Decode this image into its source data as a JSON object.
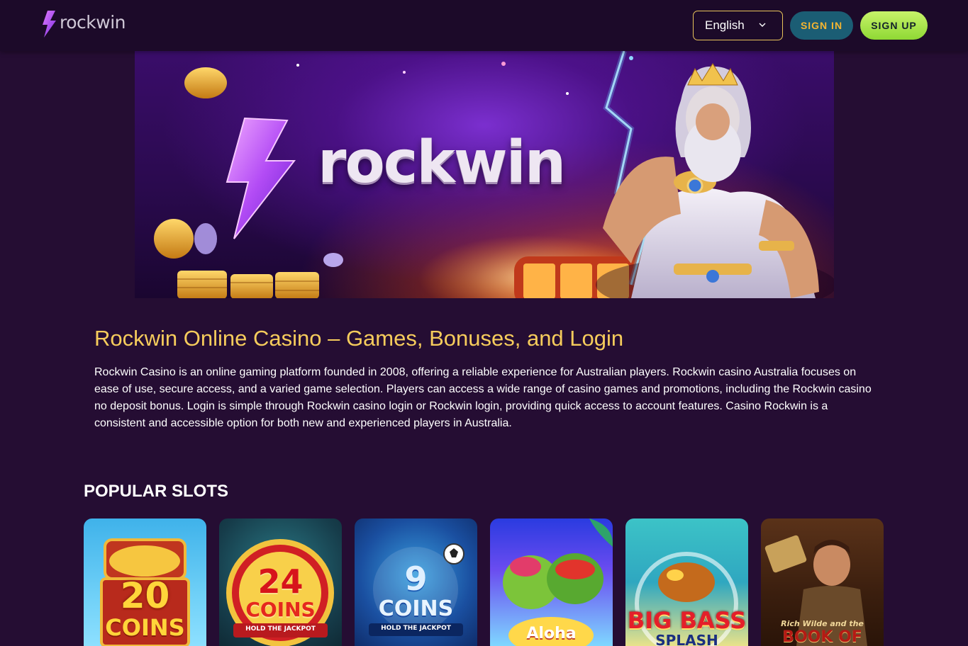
{
  "header": {
    "logo_text": "rockwin",
    "language": "English",
    "sign_in_label": "SIGN IN",
    "sign_up_label": "SIGN UP"
  },
  "banner": {
    "brand_word": "rockwin"
  },
  "intro": {
    "title": "Rockwin Online Casino – Games, Bonuses, and Login",
    "paragraph": "Rockwin Casino is an online gaming platform founded in 2008, offering a reliable experience for Australian players. Rockwin casino Australia focuses on ease of use, secure access, and a varied game selection. Players can access a wide range of casino games and promotions, including the Rockwin casino no deposit bonus. Login is simple through Rockwin casino login or Rockwin login, providing quick access to account features. Casino Rockwin is a consistent and accessible option for both new and experienced players in Australia."
  },
  "popular_slots": {
    "heading": "POPULAR SLOTS",
    "items": [
      {
        "title": "20",
        "subtitle": "COINS"
      },
      {
        "title": "24",
        "subtitle": "COINS",
        "tagline": "HOLD THE JACKPOT"
      },
      {
        "title": "9",
        "subtitle": "COINS",
        "tagline": "HOLD THE JACKPOT"
      },
      {
        "title": "Aloha"
      },
      {
        "title": "BIG BASS",
        "subtitle": "SPLASH"
      },
      {
        "title": "Rich Wilde and the",
        "subtitle": "BOOK OF"
      }
    ]
  },
  "colors": {
    "page_bg": "#250d33",
    "header_bg": "#1c0a29",
    "accent_gold": "#f6cc5c",
    "signin_bg": "#1b5d74",
    "signup_bg": "#a6e34a"
  }
}
